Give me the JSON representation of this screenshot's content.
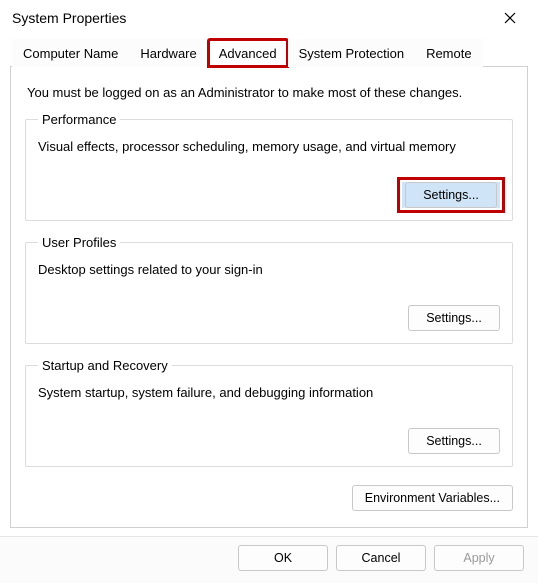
{
  "window": {
    "title": "System Properties"
  },
  "tabs": {
    "computer_name": "Computer Name",
    "hardware": "Hardware",
    "advanced": "Advanced",
    "system_protection": "System Protection",
    "remote": "Remote"
  },
  "advanced_panel": {
    "admin_note": "You must be logged on as an Administrator to make most of these changes.",
    "performance": {
      "legend": "Performance",
      "desc": "Visual effects, processor scheduling, memory usage, and virtual memory",
      "settings_btn": "Settings..."
    },
    "user_profiles": {
      "legend": "User Profiles",
      "desc": "Desktop settings related to your sign-in",
      "settings_btn": "Settings..."
    },
    "startup_recovery": {
      "legend": "Startup and Recovery",
      "desc": "System startup, system failure, and debugging information",
      "settings_btn": "Settings..."
    },
    "env_vars_btn": "Environment Variables..."
  },
  "footer": {
    "ok": "OK",
    "cancel": "Cancel",
    "apply": "Apply"
  }
}
